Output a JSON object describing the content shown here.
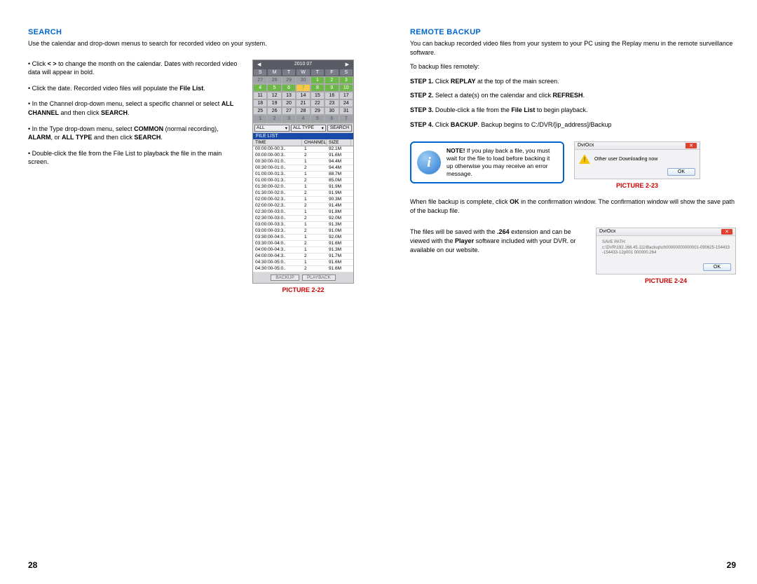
{
  "left": {
    "heading": "SEARCH",
    "intro": "Use the calendar and drop-down menus to search for recorded video on your system.",
    "bullets": [
      {
        "pre": "• Click ",
        "b1": "< >",
        "post": " to change the month on the calendar. Dates with recorded video data will appear in bold."
      },
      {
        "pre": "• Click the date. Recorded video files will populate the ",
        "b1": "File List",
        "post": "."
      },
      {
        "pre": "• In the Channel drop-down menu, select a specific channel or select ",
        "b1": "ALL CHANNEL",
        "mid": " and then click ",
        "b2": "SEARCH",
        "post": "."
      },
      {
        "pre": "• In the Type drop-down menu, select ",
        "b1": "COMMON",
        "mid": " (normal recording), ",
        "b2": "ALARM",
        "mid2": ", or ",
        "b3": "ALL TYPE",
        "mid3": " and then click ",
        "b4": "SEARCH",
        "post": "."
      },
      {
        "pre": "• Double-click the file from the File List to playback the file in the main screen.",
        "b1": "",
        "post": ""
      }
    ],
    "pic22_caption": "PICTURE 2-22",
    "calendar": {
      "month": "2010 07",
      "dow": [
        "S",
        "M",
        "T",
        "W",
        "T",
        "F",
        "S"
      ],
      "cells": [
        {
          "t": "27",
          "c": "dim"
        },
        {
          "t": "28",
          "c": "dim"
        },
        {
          "t": "29",
          "c": "dim"
        },
        {
          "t": "30",
          "c": "dim"
        },
        {
          "t": "1",
          "c": "rec"
        },
        {
          "t": "2",
          "c": "rec"
        },
        {
          "t": "3",
          "c": "rec"
        },
        {
          "t": "4",
          "c": "rec"
        },
        {
          "t": "5",
          "c": "rec"
        },
        {
          "t": "6",
          "c": "rec"
        },
        {
          "t": "7",
          "c": "sel"
        },
        {
          "t": "8",
          "c": "rec"
        },
        {
          "t": "9",
          "c": "rec"
        },
        {
          "t": "10",
          "c": "rec"
        },
        {
          "t": "11",
          "c": ""
        },
        {
          "t": "12",
          "c": ""
        },
        {
          "t": "13",
          "c": ""
        },
        {
          "t": "14",
          "c": ""
        },
        {
          "t": "15",
          "c": ""
        },
        {
          "t": "16",
          "c": ""
        },
        {
          "t": "17",
          "c": ""
        },
        {
          "t": "18",
          "c": ""
        },
        {
          "t": "19",
          "c": ""
        },
        {
          "t": "20",
          "c": ""
        },
        {
          "t": "21",
          "c": ""
        },
        {
          "t": "22",
          "c": ""
        },
        {
          "t": "23",
          "c": ""
        },
        {
          "t": "24",
          "c": ""
        },
        {
          "t": "25",
          "c": ""
        },
        {
          "t": "26",
          "c": ""
        },
        {
          "t": "27",
          "c": ""
        },
        {
          "t": "28",
          "c": ""
        },
        {
          "t": "29",
          "c": ""
        },
        {
          "t": "30",
          "c": ""
        },
        {
          "t": "31",
          "c": ""
        },
        {
          "t": "1",
          "c": "dim"
        },
        {
          "t": "2",
          "c": "dim"
        },
        {
          "t": "3",
          "c": "dim"
        },
        {
          "t": "4",
          "c": "dim"
        },
        {
          "t": "5",
          "c": "dim"
        },
        {
          "t": "6",
          "c": "dim"
        },
        {
          "t": "7",
          "c": "dim"
        }
      ],
      "channel": "ALL",
      "type": "ALL TYPE",
      "search": "SEARCH",
      "filelist_label": "FILE LIST",
      "cols": [
        "TIME",
        "CHANNEL",
        "SIZE"
      ],
      "files": [
        {
          "t": "00:00:00-00:3..",
          "c": "1",
          "s": "92.1M"
        },
        {
          "t": "00:00:00-00:3..",
          "c": "2",
          "s": "91.6M"
        },
        {
          "t": "00:30:00-01:0..",
          "c": "1",
          "s": "94.4M"
        },
        {
          "t": "00:30:00-01:0..",
          "c": "2",
          "s": "94.4M"
        },
        {
          "t": "01:00:00-01:3..",
          "c": "1",
          "s": "88.7M"
        },
        {
          "t": "01:00:00-01:3..",
          "c": "2",
          "s": "85.0M"
        },
        {
          "t": "01:30:00-02:0..",
          "c": "1",
          "s": "91.9M"
        },
        {
          "t": "01:30:00-02:0..",
          "c": "2",
          "s": "91.9M"
        },
        {
          "t": "02:00:00-02:3..",
          "c": "1",
          "s": "90.3M"
        },
        {
          "t": "02:00:00-02:3..",
          "c": "2",
          "s": "91.4M"
        },
        {
          "t": "02:30:00-03:0..",
          "c": "1",
          "s": "91.8M"
        },
        {
          "t": "02:30:00-03:0..",
          "c": "2",
          "s": "92.0M"
        },
        {
          "t": "03:00:00-03:3..",
          "c": "1",
          "s": "91.3M"
        },
        {
          "t": "03:00:00-03:3..",
          "c": "2",
          "s": "91.0M"
        },
        {
          "t": "03:30:00-04:0..",
          "c": "1",
          "s": "92.0M"
        },
        {
          "t": "03:30:00-04:0..",
          "c": "2",
          "s": "91.6M"
        },
        {
          "t": "04:00:00-04:3..",
          "c": "1",
          "s": "91.3M"
        },
        {
          "t": "04:00:00-04:3..",
          "c": "2",
          "s": "91.7M"
        },
        {
          "t": "04:30:00-05:0..",
          "c": "1",
          "s": "91.6M"
        },
        {
          "t": "04:30:00-05:0..",
          "c": "2",
          "s": "91.6M"
        }
      ],
      "backup_btn": "BACKUP",
      "playback_btn": "PLAYBACK"
    },
    "page_num": "28"
  },
  "right": {
    "heading": "REMOTE BACKUP",
    "intro": "You can backup recorded video files from your system to your PC using the Replay menu in the remote surveillance software.",
    "lead": "To backup files remotely:",
    "steps": [
      {
        "label": "STEP 1.",
        "pre": " Click ",
        "b1": "REPLAY",
        "post": " at the top of the main screen."
      },
      {
        "label": "STEP 2.",
        "pre": " Select a date(s) on the calendar and click ",
        "b1": "REFRESH",
        "post": "."
      },
      {
        "label": "STEP 3.",
        "pre": " Double-click a file from the ",
        "b1": "File List",
        "post": " to begin playback."
      },
      {
        "label": "STEP 4.",
        "pre": " Click ",
        "b1": "BACKUP",
        "post": ". Backup begins to C:/DVR/[ip_address]/Backup"
      }
    ],
    "note": {
      "label": "NOTE!",
      "text": " If you play back a file, you must wait for the file to load before backing it up otherwise you may receive an error message."
    },
    "dlg23": {
      "title": "DvrOcx",
      "msg": "Other user Downloading now",
      "ok": "OK"
    },
    "pic23_caption": "PICTURE 2-23",
    "after_note": {
      "pre": "When file backup is complete, click ",
      "b1": "OK",
      "post": " in the confirmation window. The confirmation window will show the save path of the backup file."
    },
    "ext_para": {
      "pre": "The files will be saved with the ",
      "b1": ".264",
      "mid": " extension and can be viewed with the ",
      "b2": "Player",
      "post": " software included with your DVR. or available on our website."
    },
    "dlg24": {
      "title": "DvrOcx",
      "line1": "SAVE PATH:",
      "line2": "c:\\DVR\\192.168.45.111\\Backup\\ch00000000000001-090625-154433-154433-12p001 000000.264",
      "ok": "OK"
    },
    "pic24_caption": "PICTURE 2-24",
    "page_num": "29"
  }
}
